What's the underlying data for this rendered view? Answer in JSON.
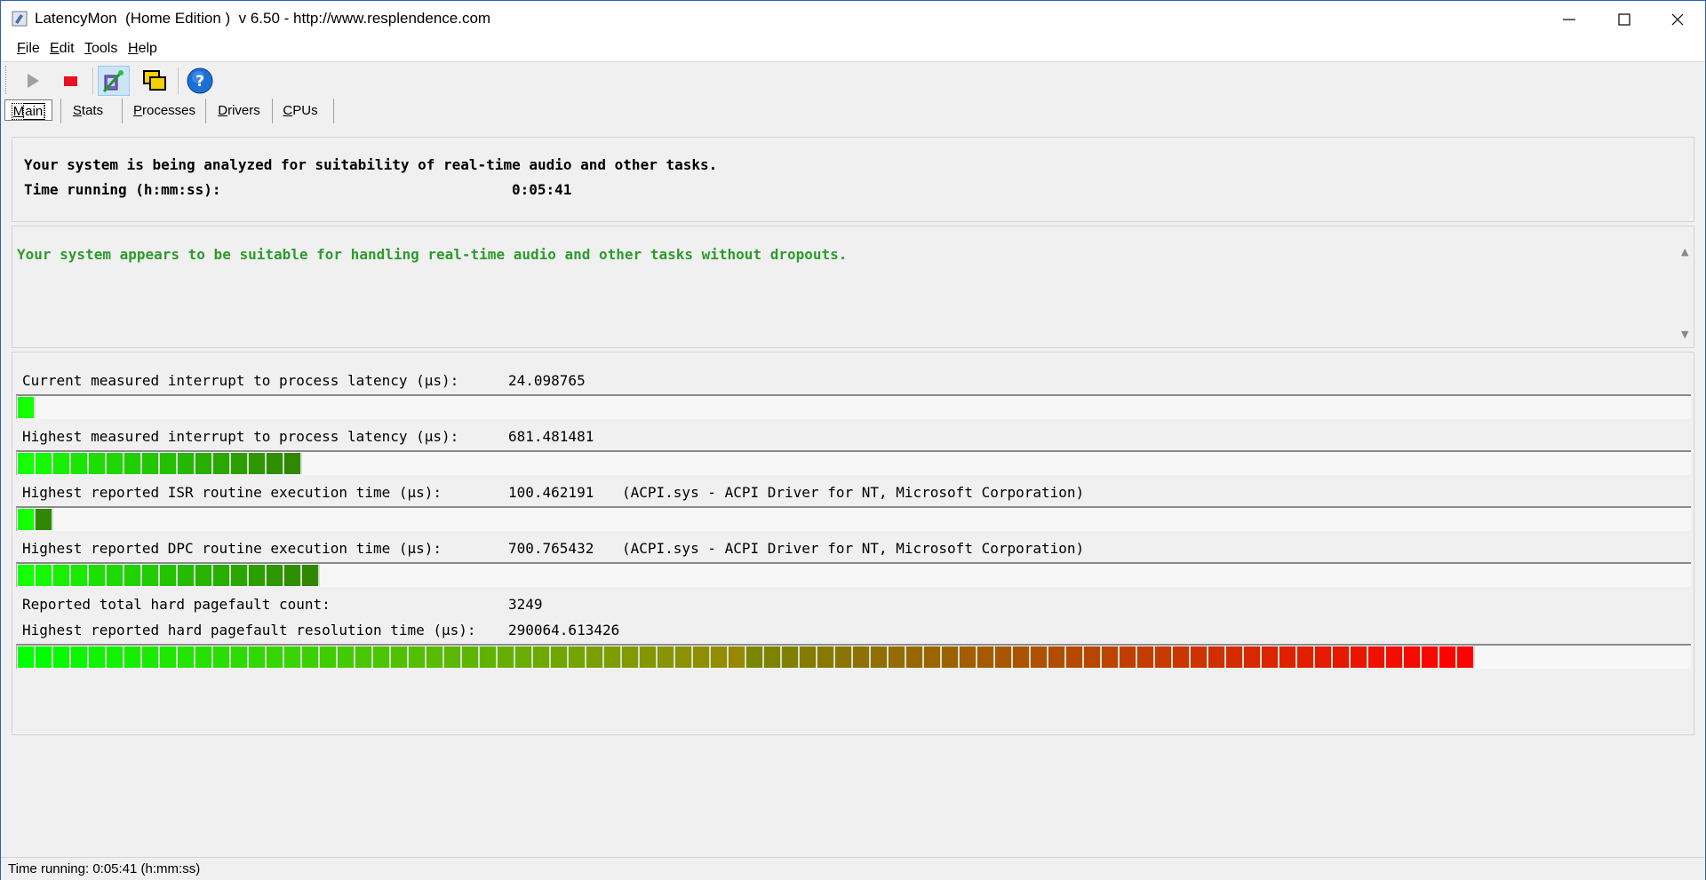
{
  "window": {
    "title": "LatencyMon  (Home Edition )  v 6.50 - http://www.resplendence.com"
  },
  "menu": [
    {
      "label": "File",
      "accel": "F",
      "rest": "ile"
    },
    {
      "label": "Edit",
      "accel": "E",
      "rest": "dit"
    },
    {
      "label": "Tools",
      "accel": "T",
      "rest": "ools"
    },
    {
      "label": "Help",
      "accel": "H",
      "rest": "elp"
    }
  ],
  "toolbar": {
    "icons": [
      "play-icon",
      "stop-icon",
      "analyze-icon",
      "windows-icon",
      "help-icon"
    ],
    "colors": {
      "stop": "#e81123",
      "help": "#1c6fd6"
    }
  },
  "tabs": [
    {
      "label": "Main",
      "accel": "M",
      "rest": "ain"
    },
    {
      "label": "Stats",
      "accel": "S",
      "rest": "tats"
    },
    {
      "label": "Processes",
      "accel": "P",
      "rest": "rocesses"
    },
    {
      "label": "Drivers",
      "accel": "D",
      "rest": "rivers"
    },
    {
      "label": "CPUs",
      "accel": "C",
      "rest": "PUs"
    }
  ],
  "main": {
    "analysis_text": "Your system is being analyzed for suitability of real-time audio and other tasks.",
    "time_running_label": "Time running (h:mm:ss):",
    "time_running_value": "0:05:41",
    "verdict": "Your system appears to be suitable for handling real-time audio and other tasks without dropouts.",
    "verdict_color": "#2e9a2e"
  },
  "stats": [
    {
      "label": "Current measured interrupt to process latency (µs):",
      "value": "24.098765",
      "extra": "",
      "bar_segments": 1
    },
    {
      "label": "Highest measured interrupt to process latency (µs):",
      "value": "681.481481",
      "extra": "",
      "bar_segments": 16
    },
    {
      "label": "Highest reported ISR routine execution time (µs):",
      "value": "100.462191",
      "extra": "(ACPI.sys - ACPI Driver for NT, Microsoft Corporation)",
      "bar_segments": 2
    },
    {
      "label": "Highest reported DPC routine execution time (µs):",
      "value": "700.765432",
      "extra": "(ACPI.sys - ACPI Driver for NT, Microsoft Corporation)",
      "bar_segments": 17
    },
    {
      "label": "Reported total hard pagefault count:",
      "value": "3249",
      "extra": ""
    },
    {
      "label": "Highest reported hard pagefault resolution time (µs):",
      "value": "290064.613426",
      "extra": "",
      "bar_segments": 82
    }
  ],
  "status": {
    "text": "Time running: 0:05:41  (h:mm:ss)"
  }
}
